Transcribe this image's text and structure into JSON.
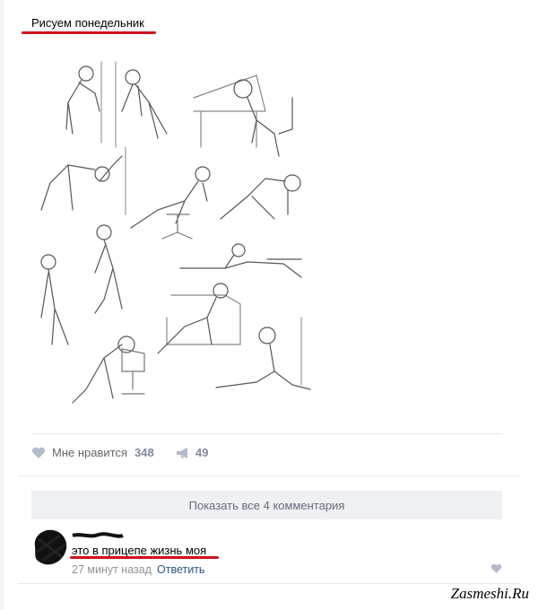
{
  "post": {
    "title": "Рисуем понедельник",
    "likes_label": "Мне нравится",
    "likes_count": "348",
    "shares_count": "49"
  },
  "comments": {
    "show_all_label": "Показать все 4 комментария",
    "item": {
      "text": "это в прицепе жизнь моя",
      "time": "27 минут назад",
      "reply_label": "Ответить"
    }
  },
  "watermark": "Zasmeshi.Ru",
  "icons": {
    "like": "heart-icon",
    "share": "megaphone-icon"
  },
  "colors": {
    "accent_red": "#d0121b",
    "link": "#2a5885",
    "muted": "#828a99"
  }
}
